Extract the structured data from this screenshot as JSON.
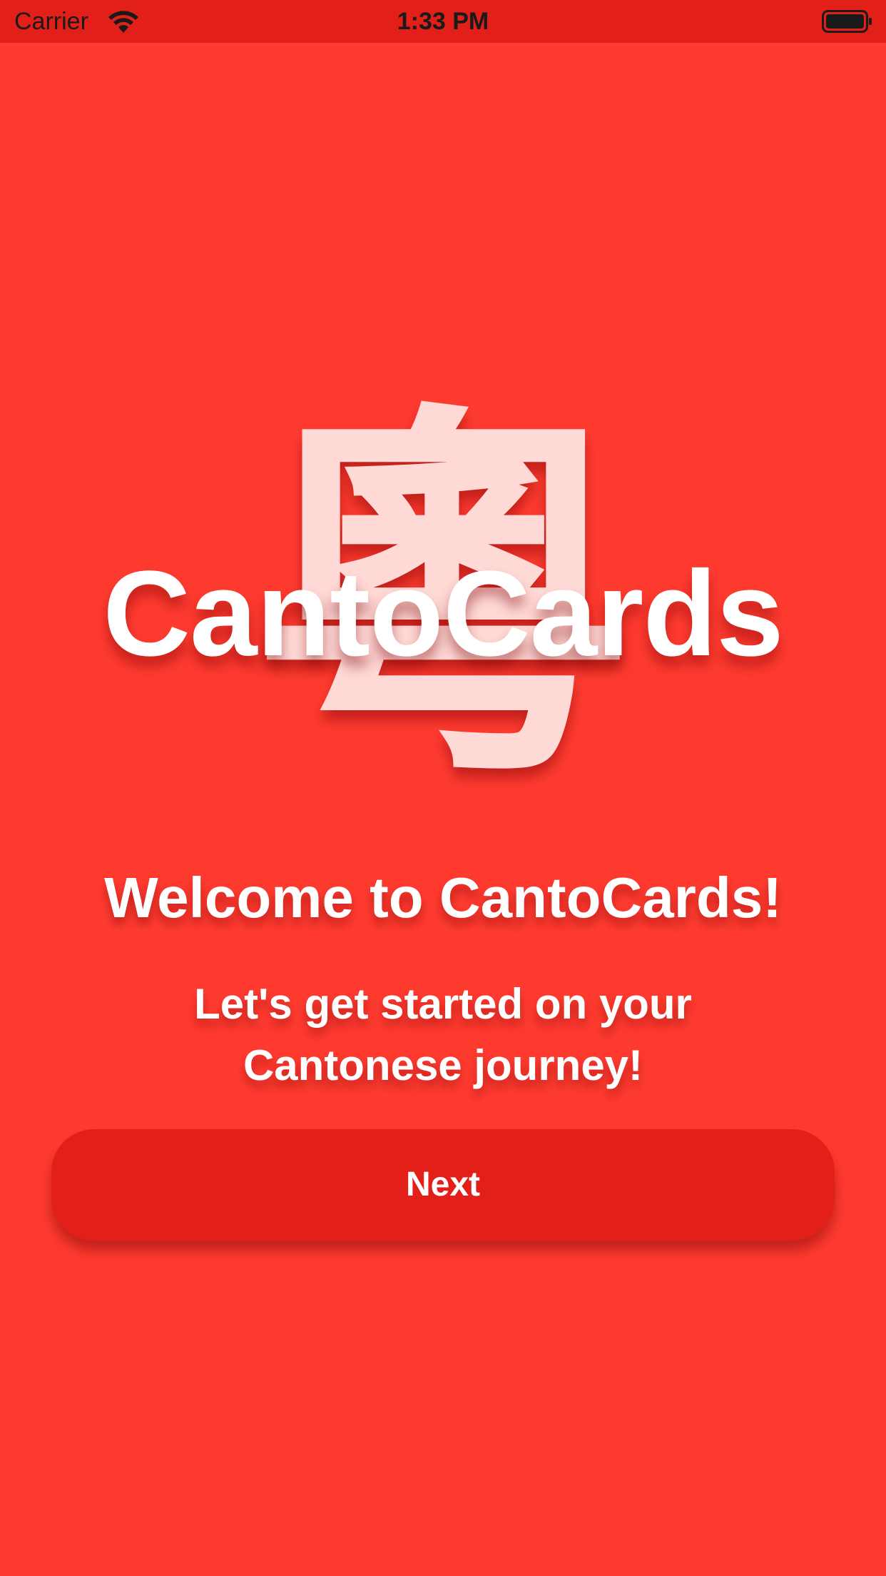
{
  "status_bar": {
    "carrier": "Carrier",
    "time": "1:33 PM",
    "wifi_icon": "wifi-icon",
    "battery_icon": "battery-icon"
  },
  "logo": {
    "glyph": "粵",
    "title": "CantoCards"
  },
  "welcome": {
    "heading": "Welcome to CantoCards!",
    "subtitle_line1": "Let's get started on your",
    "subtitle_line2": "Cantonese journey!"
  },
  "actions": {
    "next_label": "Next"
  },
  "colors": {
    "background": "#FF3B30",
    "status_bar": "#E21F18",
    "button": "#E21F18",
    "glyph": "#FFD9D6",
    "text": "#FFFFFF"
  }
}
